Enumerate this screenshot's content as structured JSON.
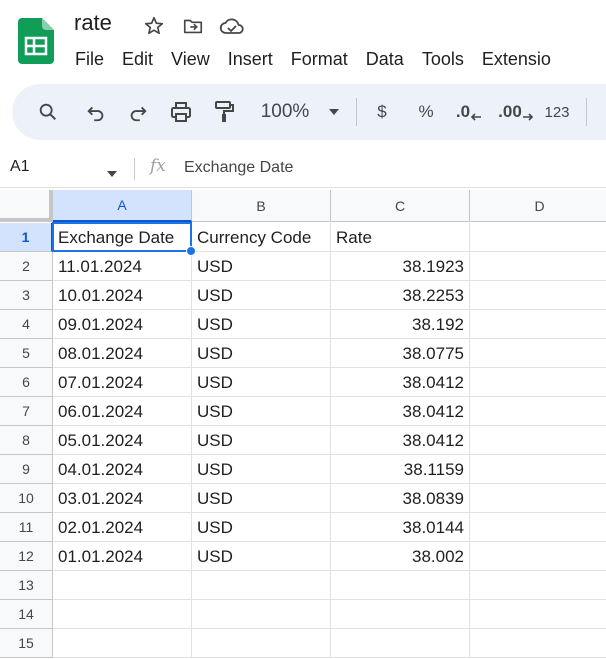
{
  "doc": {
    "title": "rate"
  },
  "menu": [
    "File",
    "Edit",
    "View",
    "Insert",
    "Format",
    "Data",
    "Tools",
    "Extensio"
  ],
  "toolbar": {
    "zoom": "100%",
    "currency": "$",
    "percent": "%",
    "dec_decrease": ".0",
    "dec_increase": ".00",
    "more_formats": "123"
  },
  "formula_bar": {
    "cell_ref": "A1",
    "fx": "fx",
    "value": "Exchange Date"
  },
  "grid": {
    "columns": [
      "A",
      "B",
      "C",
      "D"
    ],
    "selected_column": "A",
    "selected_row": 1,
    "row_numbers": [
      "1",
      "2",
      "3",
      "4",
      "5",
      "6",
      "7",
      "8",
      "9",
      "10",
      "11",
      "12",
      "13",
      "14",
      "15"
    ],
    "rows": [
      [
        "Exchange Date",
        "Currency Code",
        "Rate",
        ""
      ],
      [
        "11.01.2024",
        "USD",
        "38.1923",
        ""
      ],
      [
        "10.01.2024",
        "USD",
        "38.2253",
        ""
      ],
      [
        "09.01.2024",
        "USD",
        "38.192",
        ""
      ],
      [
        "08.01.2024",
        "USD",
        "38.0775",
        ""
      ],
      [
        "07.01.2024",
        "USD",
        "38.0412",
        ""
      ],
      [
        "06.01.2024",
        "USD",
        "38.0412",
        ""
      ],
      [
        "05.01.2024",
        "USD",
        "38.0412",
        ""
      ],
      [
        "04.01.2024",
        "USD",
        "38.1159",
        ""
      ],
      [
        "03.01.2024",
        "USD",
        "38.0839",
        ""
      ],
      [
        "02.01.2024",
        "USD",
        "38.0144",
        ""
      ],
      [
        "01.01.2024",
        "USD",
        "38.002",
        ""
      ],
      [
        "",
        "",
        "",
        ""
      ],
      [
        "",
        "",
        "",
        ""
      ],
      [
        "",
        "",
        "",
        ""
      ]
    ]
  },
  "colors": {
    "sheets_green": "#0f9d58",
    "toolbar_bg": "#edf2fa",
    "selection_blue": "#1a73e8",
    "header_selected_bg": "#d3e3fd"
  }
}
